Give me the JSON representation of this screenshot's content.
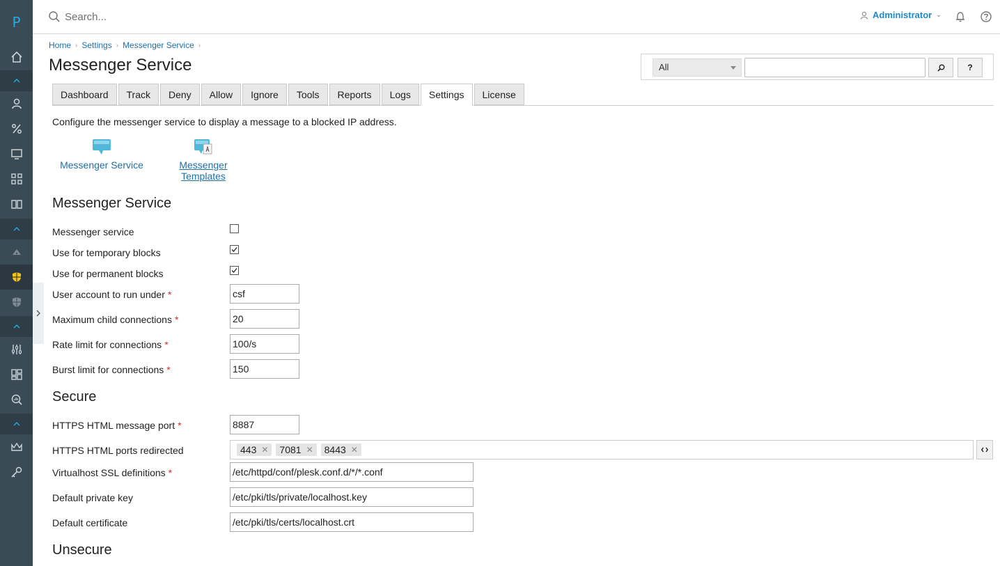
{
  "app": {
    "logo": "P"
  },
  "topbar": {
    "search_placeholder": "Search...",
    "user_name": "Administrator"
  },
  "breadcrumb": [
    "Home",
    "Settings",
    "Messenger Service"
  ],
  "page_title": "Messenger Service",
  "filter": {
    "select_value": "All",
    "search_button": "⌕",
    "help_button": "?"
  },
  "tabs": [
    "Dashboard",
    "Track",
    "Deny",
    "Allow",
    "Ignore",
    "Tools",
    "Reports",
    "Logs",
    "Settings",
    "License"
  ],
  "active_tab": "Settings",
  "intro": "Configure the messenger service to display a message to a blocked IP address.",
  "tools": {
    "service_label": "Messenger Service",
    "templates_line1": "Messenger",
    "templates_line2": "Templates"
  },
  "sections": {
    "messenger": "Messenger Service",
    "secure": "Secure",
    "unsecure": "Unsecure"
  },
  "fields": {
    "messenger_service": {
      "label": "Messenger service",
      "checked": false
    },
    "temporary_blocks": {
      "label": "Use for temporary blocks",
      "checked": true
    },
    "permanent_blocks": {
      "label": "Use for permanent blocks",
      "checked": true
    },
    "user_account": {
      "label": "User account to run under",
      "value": "csf"
    },
    "max_child": {
      "label": "Maximum child connections",
      "value": "20"
    },
    "rate_limit": {
      "label": "Rate limit for connections",
      "value": "100/s"
    },
    "burst_limit": {
      "label": "Burst limit for connections",
      "value": "150"
    },
    "https_port": {
      "label": "HTTPS HTML message port",
      "value": "8887"
    },
    "https_redirected": {
      "label": "HTTPS HTML ports redirected",
      "ports": [
        "443",
        "7081",
        "8443"
      ]
    },
    "vhost_ssl": {
      "label": "Virtualhost SSL definitions",
      "value": "/etc/httpd/conf/plesk.conf.d/*/*.conf"
    },
    "private_key": {
      "label": "Default private key",
      "value": "/etc/pki/tls/private/localhost.key"
    },
    "certificate": {
      "label": "Default certificate",
      "value": "/etc/pki/tls/certs/localhost.crt"
    }
  },
  "required_mark": "*",
  "colors": {
    "rail": "#3b4b56",
    "link": "#1e6fa8",
    "accent": "#28aade",
    "required": "#d0312d"
  }
}
